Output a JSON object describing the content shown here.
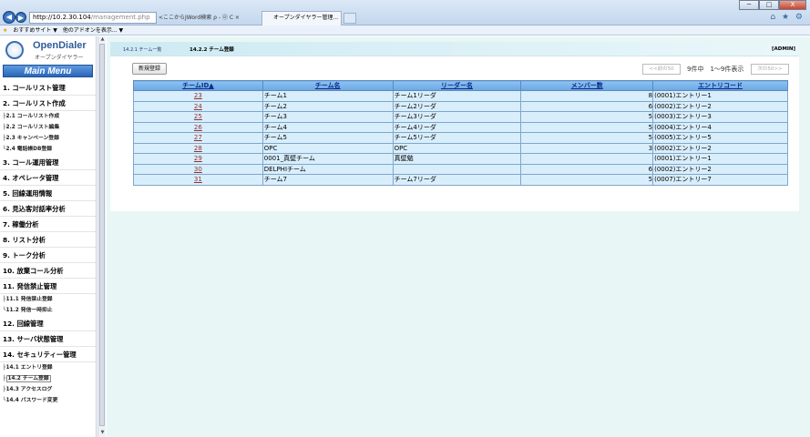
{
  "browser": {
    "nav_back": "◀",
    "nav_fwd": "▶",
    "address_host": "http://10.2.30.104",
    "address_path": "/management.php",
    "search_text": "<ここからJWord検索 ρ - ㉧ C ×",
    "tab_title": "オープンダイヤラー管理...",
    "tab_close": "×",
    "window_min": "─",
    "window_max": "□",
    "window_close": "X",
    "tools_icons": "⌂ ★ ⚙"
  },
  "favorites": {
    "star": "★",
    "item1": "おすすめサイト ▼",
    "item2": "他のアドオンを表示... ▼"
  },
  "logo": {
    "name": "OpenDialer",
    "sub": "オープンダイヤラー"
  },
  "main_menu": "Main Menu",
  "menu": {
    "s1": "1. コールリスト管理",
    "s2": "2. コールリスト作成",
    "s2_1": "├2.1 コールリスト作成",
    "s2_2": "├2.2 コールリスト編集",
    "s2_3": "├2.3 キャンペーン登録",
    "s2_4": "└2.4 電話帳DB登録",
    "s3": "3. コール運用管理",
    "s4": "4. オペレータ管理",
    "s5": "5. 回線運用情報",
    "s6": "6. 見込客対話率分析",
    "s7": "7. 稼働分析",
    "s8": "8. リスト分析",
    "s9": "9. トーク分析",
    "s10": "10. 放棄コール分析",
    "s11": "11. 発信禁止管理",
    "s11_1": "├11.1 発信禁止登録",
    "s11_2": "└11.2 発信一時抑止",
    "s12": "12. 回線管理",
    "s13": "13. サーバ状態管理",
    "s14": "14. セキュリティー管理",
    "s14_1": "├14.1 エントリ登録",
    "s14_2_prefix": "├",
    "s14_2": "14.2 チーム登録",
    "s14_3": "├14.3 アクセスログ",
    "s14_4": "└14.4 パスワード変更"
  },
  "page": {
    "tab_inactive": "14.2.1 チーム一覧",
    "tab_active": "14.2.2 チーム登録",
    "admin": "[ADMIN]",
    "new_button": "新規登録",
    "prev_button": "<<前の50",
    "next_button": "次の50>>",
    "page_info": "9件中　1〜9件表示"
  },
  "table": {
    "headers": [
      "チームID▲",
      "チーム名",
      "リーダー名",
      "メンバー数",
      "エントリコード"
    ],
    "rows": [
      [
        "23",
        "チーム1",
        "チーム1リーダ",
        "8",
        "(0001)エントリー1"
      ],
      [
        "24",
        "チーム2",
        "チーム2リーダ",
        "6",
        "(0002)エントリー2"
      ],
      [
        "25",
        "チーム3",
        "チーム3リーダ",
        "5",
        "(0003)エントリー3"
      ],
      [
        "26",
        "チーム4",
        "チーム4リーダ",
        "5",
        "(0004)エントリー4"
      ],
      [
        "27",
        "チーム5",
        "チーム5リーダ",
        "5",
        "(0005)エントリー5"
      ],
      [
        "28",
        "OPC",
        "OPC",
        "3",
        "(0002)エントリー2"
      ],
      [
        "29",
        "0001_真壁チーム",
        "真壁勉",
        "",
        "(0001)エントリー1"
      ],
      [
        "30",
        "DELPHIチーム",
        "",
        "6",
        "(0002)エントリー2"
      ],
      [
        "31",
        "チーム7",
        "チーム7リーダ",
        "5",
        "(0007)エントリー7"
      ]
    ]
  }
}
